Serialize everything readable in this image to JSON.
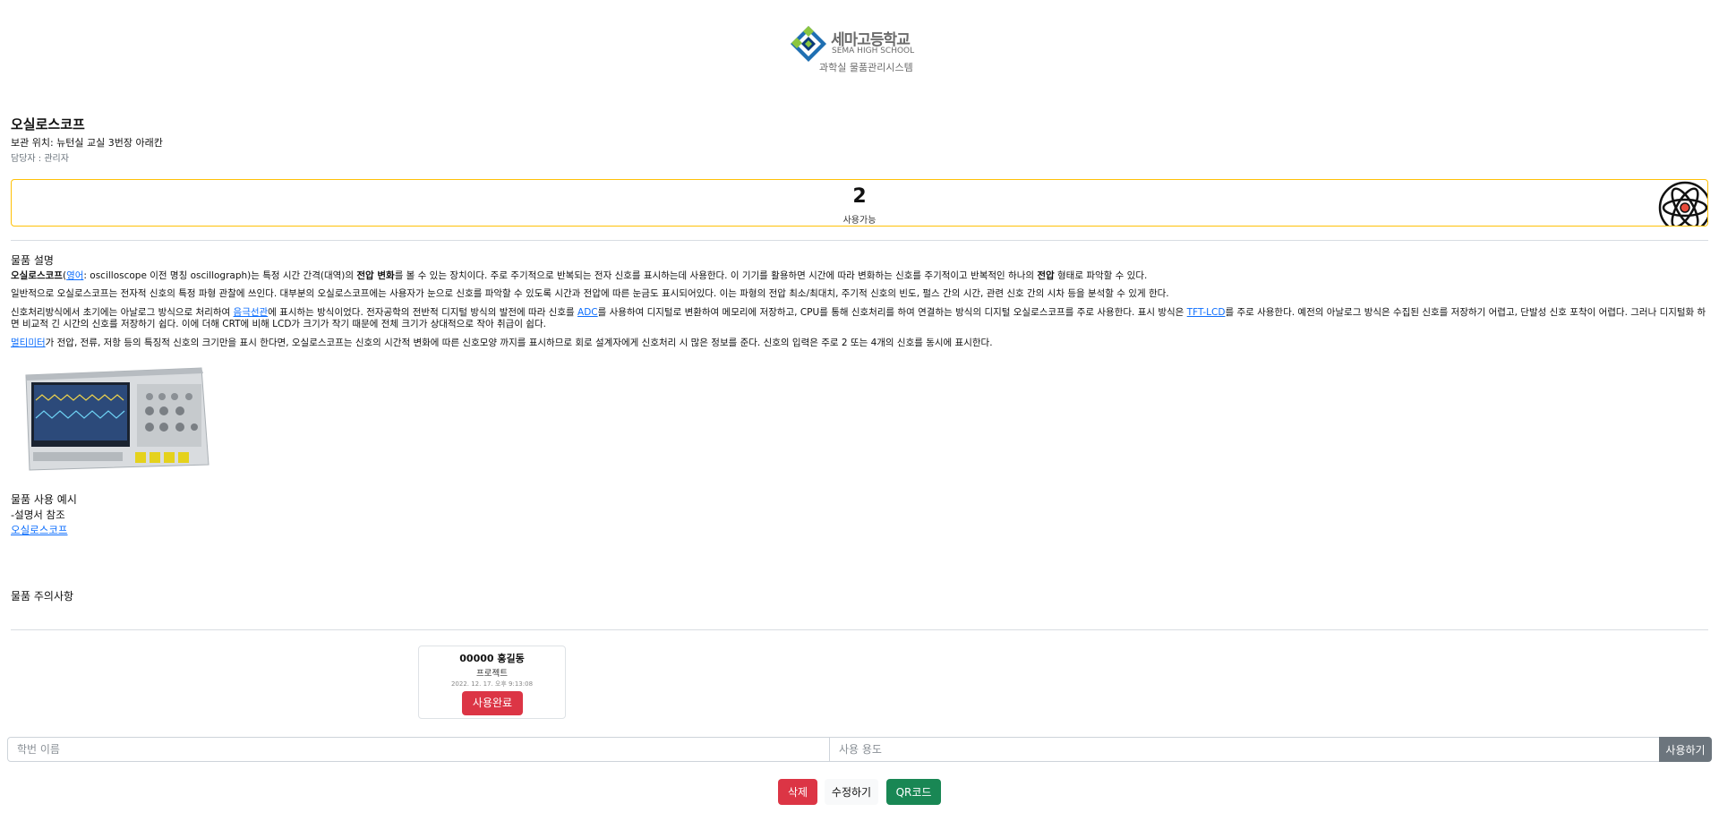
{
  "header": {
    "school_name_ko": "세마고등학교",
    "school_name_en": "SEMA HIGH SCHOOL",
    "system_name": "과학실 물품관리시스템",
    "logo_colors": {
      "green": "#8cc63f",
      "blue": "#1f6fb2",
      "navy": "#0b3b79"
    }
  },
  "item": {
    "name": "오실로스코프",
    "location": "보관 위치: 뉴턴실 교실 3번장 아래칸",
    "manager": "담당자 : 관리자"
  },
  "status": {
    "count": "2",
    "label": "사용가능",
    "border_color": "#ffc107",
    "icon": "atom-icon"
  },
  "description": {
    "title": "물품 설명",
    "p1": {
      "term": "오실로스코프",
      "lang_link": "영어",
      "text_a": ": oscilloscope 이전 명칭 oscillograph)는 특정 시간 간격(대역)의 ",
      "bold_a": "전압 변화",
      "text_b": "를 볼 수 있는 장치이다. 주로 주기적으로 반복되는 전자 신호를 표시하는데 사용한다. 이 기기를 활용하면 시간에 따라 변화하는 신호를 주기적이고 반복적인 하나의 ",
      "bold_b": "전압",
      "text_c": " 형태로 파악할 수 있다."
    },
    "p2": "일반적으로 오실로스코프는 전자적 신호의 특정 파형 관찰에 쓰인다. 대부분의 오실로스코프에는 사용자가 눈으로 신호를 파악할 수 있도록 시간과 전압에 따른 눈금도 표시되어있다. 이는 파형의 전압 최소/최대치, 주기적 신호의 빈도, 펄스 간의 시간, 관련 신호 간의 시차 등을 분석할 수 있게 한다.",
    "p3": {
      "text_a": "신호처리방식에서 초기에는 아날로그 방식으로 처리하여 ",
      "link_a": "음극선관",
      "text_b": "에 표시하는 방식이었다. 전자공학의 전반적 디지털 방식의 발전에 따라 신호를 ",
      "link_b": "ADC",
      "text_c": "를 사용하여 디지털로 변환하여 메모리에 저장하고, CPU를 통해 신호처리를 하여 연결하는 방식의 디지털 오실로스코프를 주로 사용한다. 표시 방식은 ",
      "link_c": "TFT-LCD",
      "text_d": "를 주로 사용한다. 예전의 아날로그 방식은 수집된 신호를 저장하기 어렵고, 단발성 신호 포착이 어렵다. 그러나 디지털화 하면 비교적 긴 시간의 신호를 저장하기 쉽다. 이에 더해 CRT에 비해 LCD가 크기가 작기 때문에 전체 크기가 상대적으로 작아 취급이 쉽다."
    },
    "p4": {
      "link_a": "멀티미터",
      "text_a": "가 전압, 전류, 저항 등의 특징적 신호의 크기만을 표시 한다면, 오실로스코프는 신호의 시간적 변화에 따른 신호모양 까지를 표시하므로 회로 설계자에게 신호처리 시 많은 정보를 준다. 신호의 입력은 주로 2 또는 4개의 신호를 동시에 표시한다."
    }
  },
  "usage": {
    "title": "물품 사용 예시",
    "line": "-설명서 참조",
    "link": "오실로스코프"
  },
  "caution": {
    "title": "물품 주의사항"
  },
  "record": {
    "name": "00000 홍길동",
    "purpose": "프로젝트",
    "time": "2022. 12. 17. 오후 9:13:08",
    "button": "사용완료"
  },
  "form": {
    "student_placeholder": "학번 이름",
    "purpose_placeholder": "사용 용도",
    "submit": "사용하기"
  },
  "actions": {
    "delete": "삭제",
    "edit": "수정하기",
    "qr": "QR코드"
  }
}
